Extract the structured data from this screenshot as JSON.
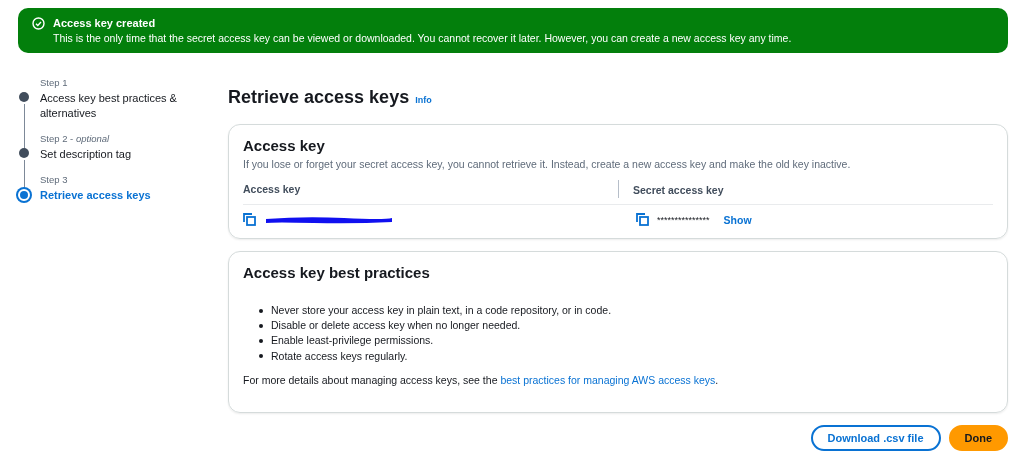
{
  "banner": {
    "title": "Access key created",
    "message": "This is the only time that the secret access key can be viewed or downloaded. You cannot recover it later. However, you can create a new access key any time."
  },
  "steps": [
    {
      "label": "Step 1",
      "title": "Access key best practices & alternatives",
      "selected": false
    },
    {
      "label": "Step 2 - *optional*",
      "title": "Set description tag",
      "selected": false
    },
    {
      "label": "Step 3",
      "title": "Retrieve access keys",
      "selected": true
    }
  ],
  "page": {
    "title": "Retrieve access keys",
    "info": "Info"
  },
  "access_key_card": {
    "title": "Access key",
    "description": "If you lose or forget your secret access key, you cannot retrieve it. Instead, create a new access key and make the old key inactive.",
    "columns": [
      "Access key",
      "Secret access key"
    ],
    "secret": "***************",
    "show": "Show"
  },
  "best_practices": {
    "title": "Access key best practices",
    "items": [
      "Never store your access key in plain text, in a code repository, or in code.",
      "Disable or delete access key when no longer needed.",
      "Enable least-privilege permissions.",
      "Rotate access keys regularly."
    ],
    "note_before": "For more details about managing access keys, see the ",
    "note_link": "best practices for managing AWS access keys",
    "note_after": "."
  },
  "buttons": [
    {
      "label": "Download .csv file",
      "kind": "secondary"
    },
    {
      "label": "Done",
      "kind": "primary"
    }
  ]
}
